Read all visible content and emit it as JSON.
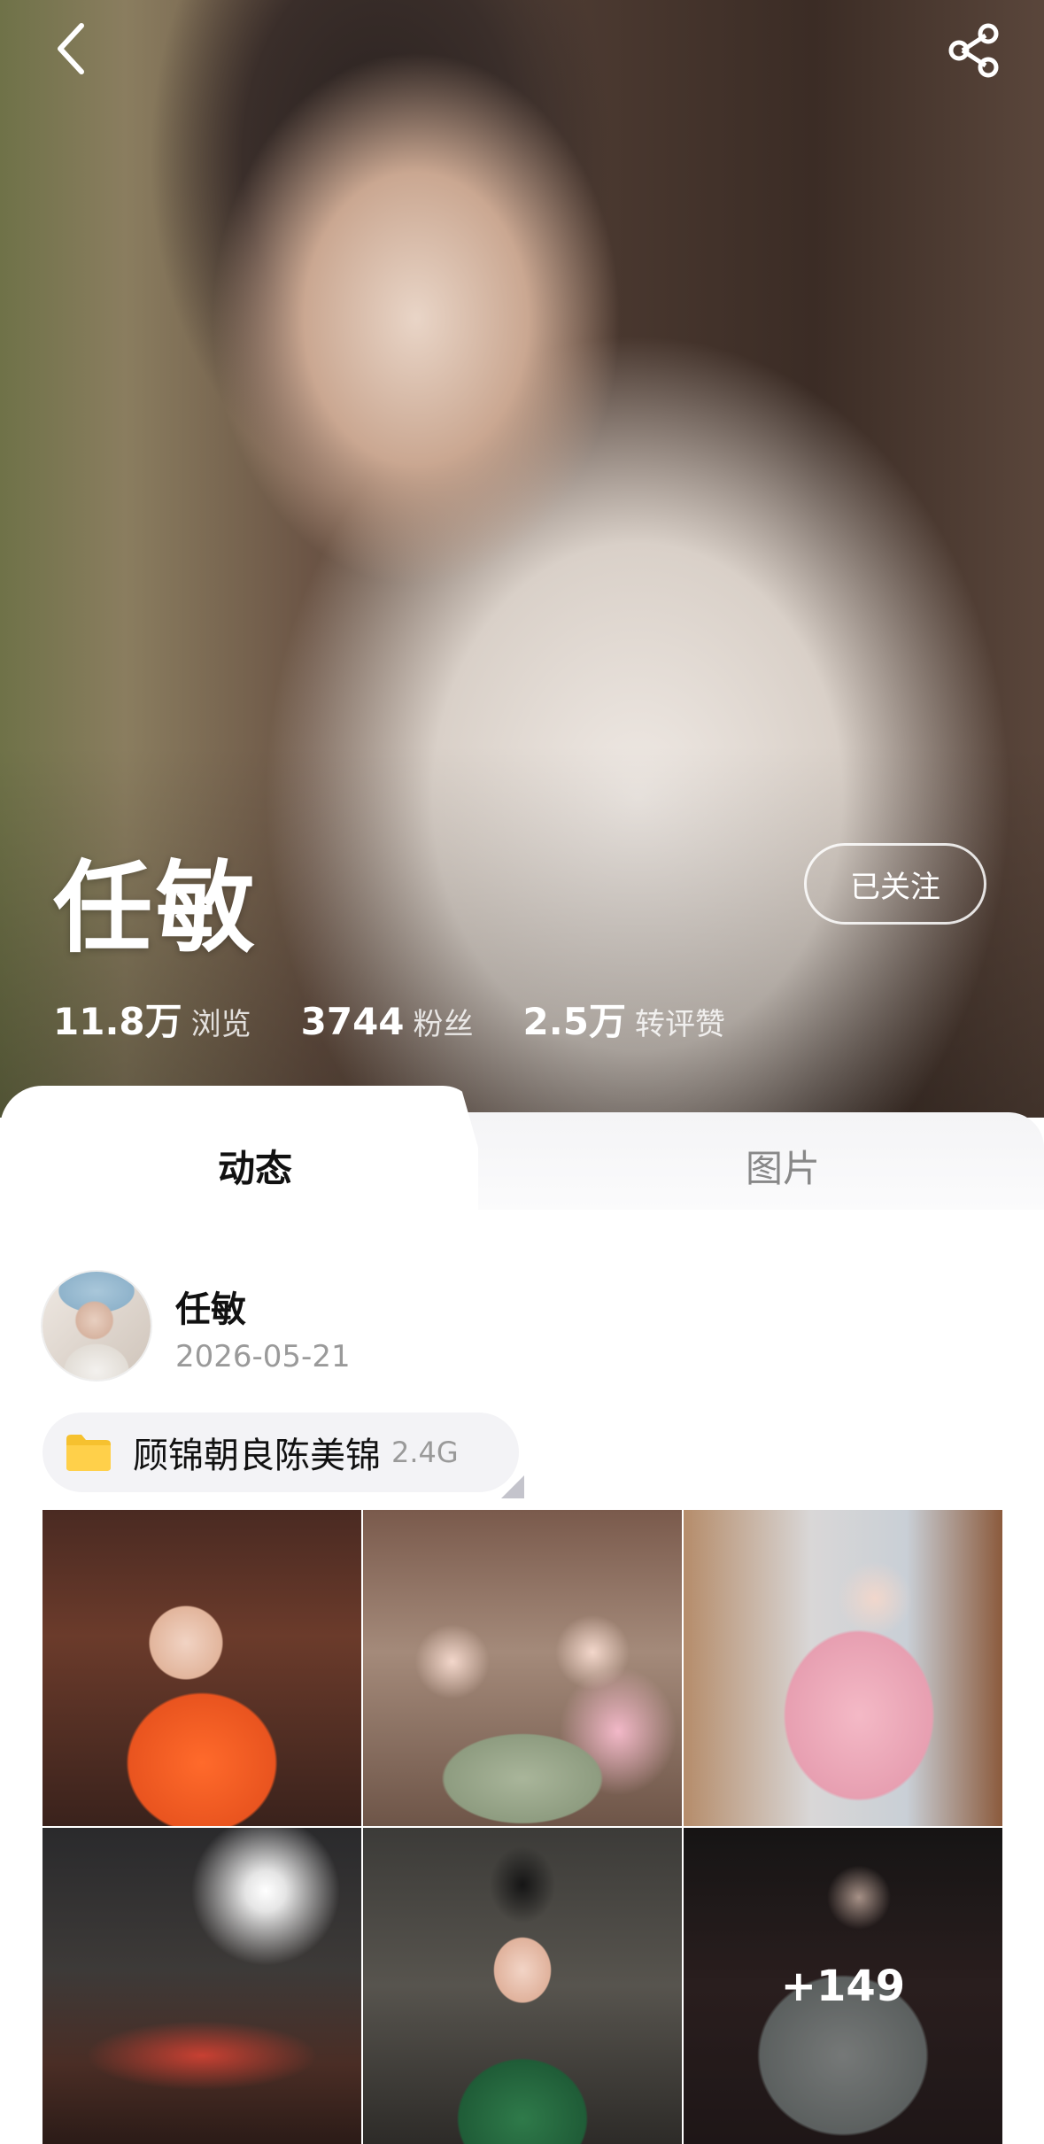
{
  "profile": {
    "name": "任敏",
    "follow_label": "已关注"
  },
  "stats": [
    {
      "value": "11.8万",
      "label": "浏览"
    },
    {
      "value": "3744",
      "label": "粉丝"
    },
    {
      "value": "2.5万",
      "label": "转评赞"
    }
  ],
  "tabs": [
    {
      "label": "动态",
      "active": true
    },
    {
      "label": "图片",
      "active": false
    }
  ],
  "post": {
    "author": "任敏",
    "date": "2026-05-21",
    "folder": {
      "name": "顾锦朝良陈美锦",
      "size": "2.4G"
    },
    "more_count": "+149"
  },
  "icons": {
    "back": "back-arrow-icon",
    "share": "share-icon",
    "folder": "folder-icon"
  },
  "colors": {
    "folder_icon": "#f6c12f",
    "active_tab_text": "#111111",
    "inactive_tab_text": "#888888"
  }
}
